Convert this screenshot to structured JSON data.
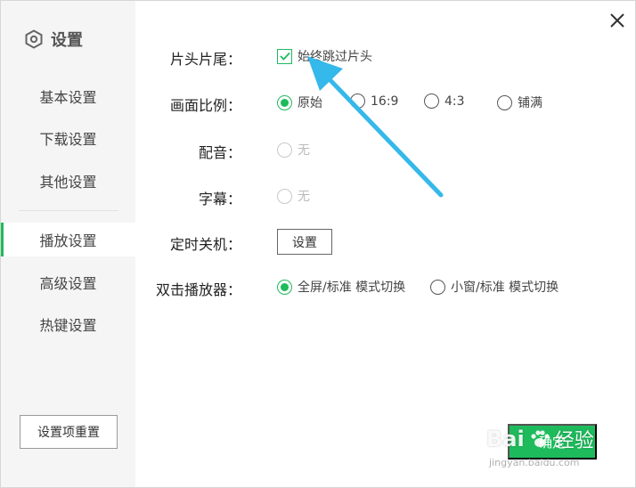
{
  "sidebar": {
    "title": "设置",
    "items": [
      {
        "label": "基本设置",
        "active": false
      },
      {
        "label": "下载设置",
        "active": false
      },
      {
        "label": "其他设置",
        "active": false
      },
      {
        "label": "播放设置",
        "active": true
      },
      {
        "label": "高级设置",
        "active": false
      },
      {
        "label": "热键设置",
        "active": false
      }
    ],
    "reset_label": "设置项重置"
  },
  "settings": {
    "intro_outro": {
      "label": "片头片尾：",
      "option": "始终跳过片头",
      "checked": true
    },
    "aspect_ratio": {
      "label": "画面比例：",
      "options": [
        "原始",
        "16:9",
        "4:3",
        "铺满"
      ],
      "selected": "原始"
    },
    "audio": {
      "label": "配音：",
      "option": "无"
    },
    "subtitle": {
      "label": "字幕：",
      "option": "无"
    },
    "timer": {
      "label": "定时关机：",
      "button": "设置"
    },
    "double_click": {
      "label": "双击播放器：",
      "options": [
        "全屏/标准 模式切换",
        "小窗/标准 模式切换"
      ],
      "selected": "全屏/标准 模式切换"
    }
  },
  "footer": {
    "confirm_label": "确定"
  },
  "watermark": {
    "brand": "Bai",
    "brand2": "经验",
    "url": "jingyan.baidu.com"
  },
  "colors": {
    "accent": "#1ebb5c",
    "annotation_arrow": "#35b8ea"
  }
}
